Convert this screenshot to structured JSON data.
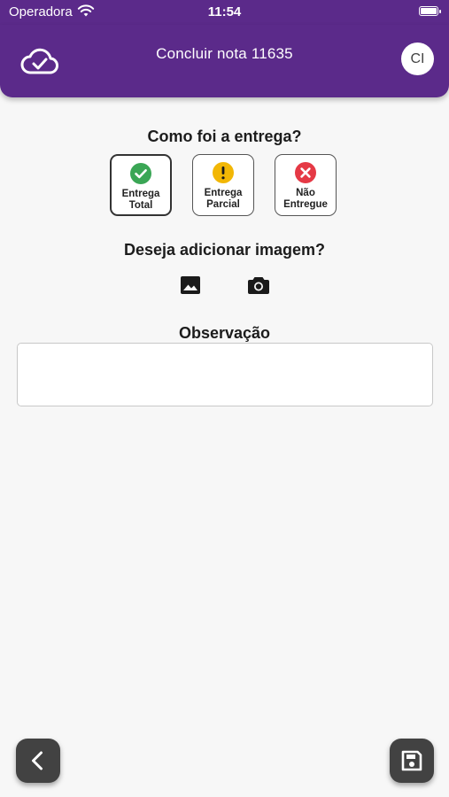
{
  "status_bar": {
    "carrier": "Operadora",
    "time": "11:54"
  },
  "header": {
    "title": "Concluir nota 11635",
    "avatar_initials": "CI",
    "left_icon": "cloud-check-icon"
  },
  "delivery": {
    "question": "Como foi a entrega?",
    "selected": "total",
    "options": [
      {
        "id": "total",
        "label": "Entrega\nTotal",
        "icon": "check-circle-icon",
        "color": "#3aa655"
      },
      {
        "id": "parcial",
        "label": "Entrega\nParcial",
        "icon": "exclamation-circle-icon",
        "color": "#f2b705"
      },
      {
        "id": "nao",
        "label": "Não\nEntregue",
        "icon": "x-circle-icon",
        "color": "#e53945"
      }
    ]
  },
  "image": {
    "question": "Deseja adicionar imagem?",
    "gallery_icon": "image-icon",
    "camera_icon": "camera-icon"
  },
  "observation": {
    "label": "Observação",
    "value": "",
    "placeholder": ""
  },
  "footer": {
    "back_icon": "chevron-left-icon",
    "save_icon": "save-icon"
  },
  "colors": {
    "primary": "#5b2a8a",
    "fab": "#424242"
  }
}
